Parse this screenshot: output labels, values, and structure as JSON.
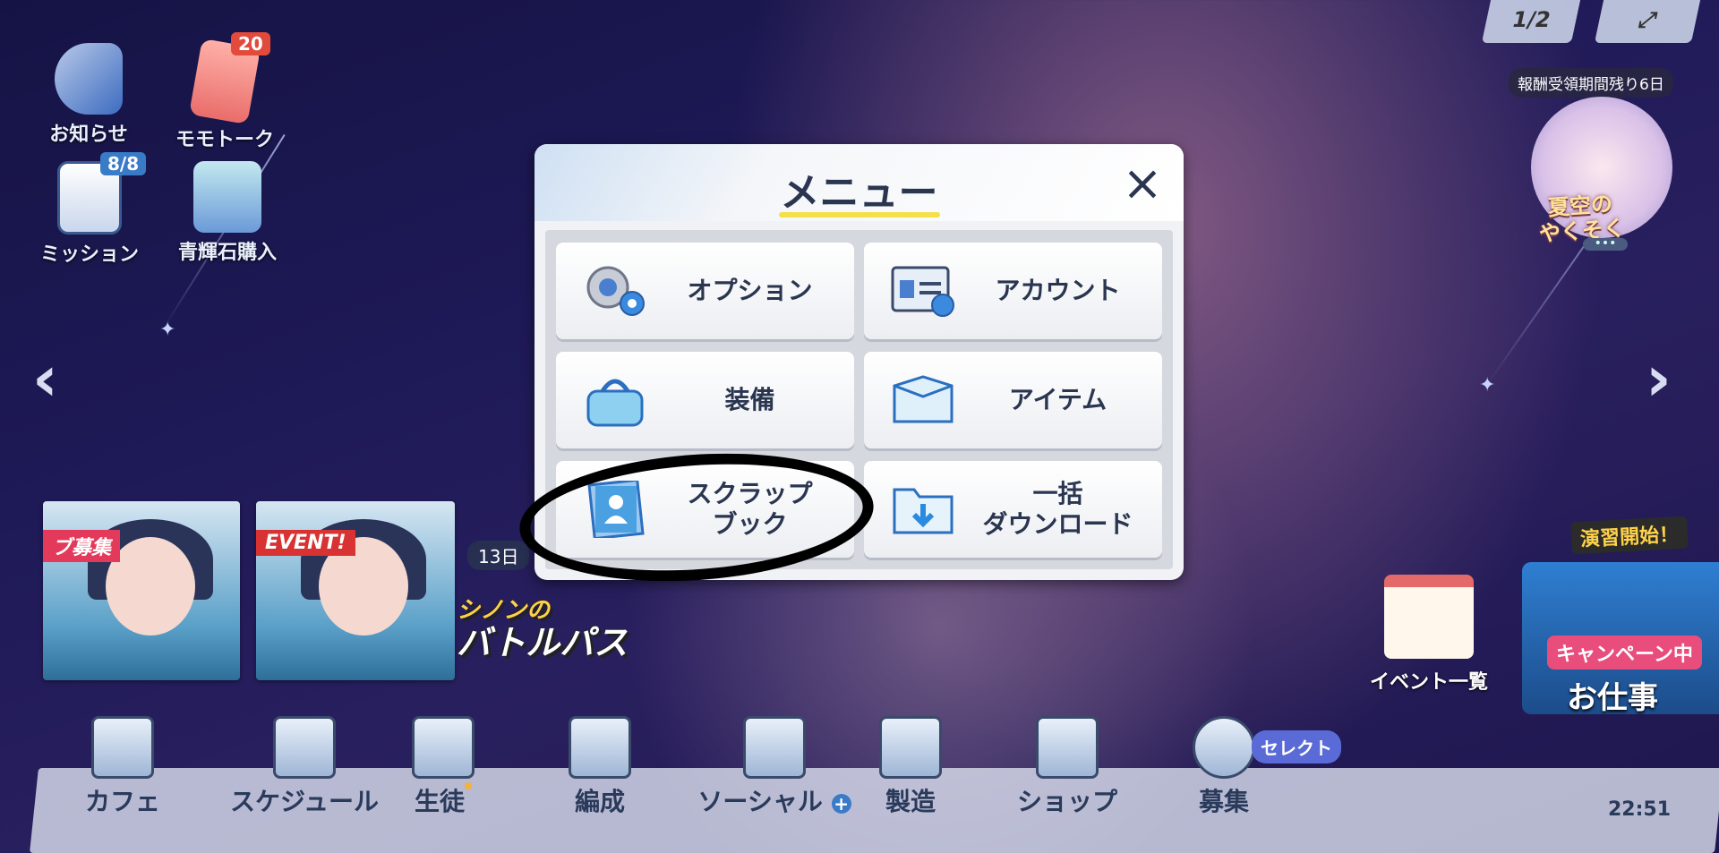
{
  "top_left": {
    "news": {
      "label": "お知らせ"
    },
    "momotalk": {
      "label": "モモトーク",
      "badge": "20"
    },
    "mission": {
      "label": "ミッション",
      "badge": "8/8"
    },
    "pyroxene": {
      "label": "青輝石購入"
    }
  },
  "top_right": {
    "page_indicator": "1/2",
    "reward_period": "報酬受領期間残り6日",
    "event_title_line1": "夏空の",
    "event_title_line2": "やくそく"
  },
  "banners": {
    "recruit_tag": "ブ募集",
    "event_tag": "EVENT!",
    "days_left": "13日",
    "battlepass_line1": "シノンの",
    "battlepass_line2": "バトルパス"
  },
  "right_panel": {
    "event_list": "イベント一覧",
    "training_start": "演習開始！",
    "campaign": "キャンペーン中",
    "work": "お仕事"
  },
  "menu": {
    "title": "メニュー",
    "items": [
      {
        "label": "オプション",
        "icon": "gear-icon"
      },
      {
        "label": "アカウント",
        "icon": "account-card-icon"
      },
      {
        "label": "装備",
        "icon": "bag-icon"
      },
      {
        "label": "アイテム",
        "icon": "item-box-icon"
      },
      {
        "label": "スクラップ\nブック",
        "icon": "scrapbook-icon"
      },
      {
        "label": "一括\nダウンロード",
        "icon": "download-folder-icon"
      }
    ]
  },
  "bottom_nav": [
    {
      "label": "カフェ",
      "icon": "cafe-cup-icon"
    },
    {
      "label": "スケジュール",
      "icon": "schedule-building-icon"
    },
    {
      "label": "生徒",
      "icon": "student-card-icon"
    },
    {
      "label": "編成",
      "icon": "formation-icon"
    },
    {
      "label": "ソーシャル",
      "icon": "social-chat-icon"
    },
    {
      "label": "製造",
      "icon": "craft-icon"
    },
    {
      "label": "ショップ",
      "icon": "shop-icon"
    },
    {
      "label": "募集",
      "icon": "recruit-icon"
    }
  ],
  "recruit_select": "セレクト",
  "clock": "22:51",
  "colors": {
    "accent_yellow": "#f5e04a",
    "badge_red": "#e24a3b",
    "text_navy": "#2a3550"
  }
}
